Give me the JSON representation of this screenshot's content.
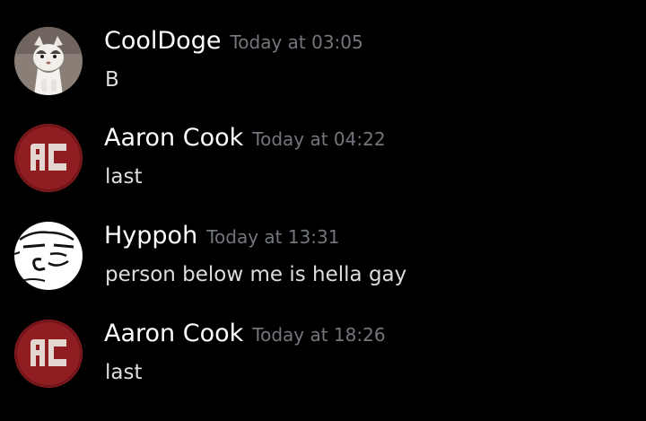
{
  "messages": [
    {
      "username": "CoolDoge",
      "timestamp": "Today at 03:05",
      "text": "B",
      "avatar": "cat-photo-avatar"
    },
    {
      "username": "Aaron Cook",
      "timestamp": "Today at 04:22",
      "text": "last",
      "avatar": "red-ac-logo-avatar"
    },
    {
      "username": "Hyppoh",
      "timestamp": "Today at 13:31",
      "text": "person below me is hella gay",
      "avatar": "sketch-face-avatar"
    },
    {
      "username": "Aaron Cook",
      "timestamp": "Today at 18:26",
      "text": "last",
      "avatar": "red-ac-logo-avatar"
    }
  ],
  "colors": {
    "background": "#000000",
    "username": "#ffffff",
    "timestamp": "#72767d",
    "message_text": "#dcddde",
    "ac_logo_red": "#8f1d22"
  }
}
